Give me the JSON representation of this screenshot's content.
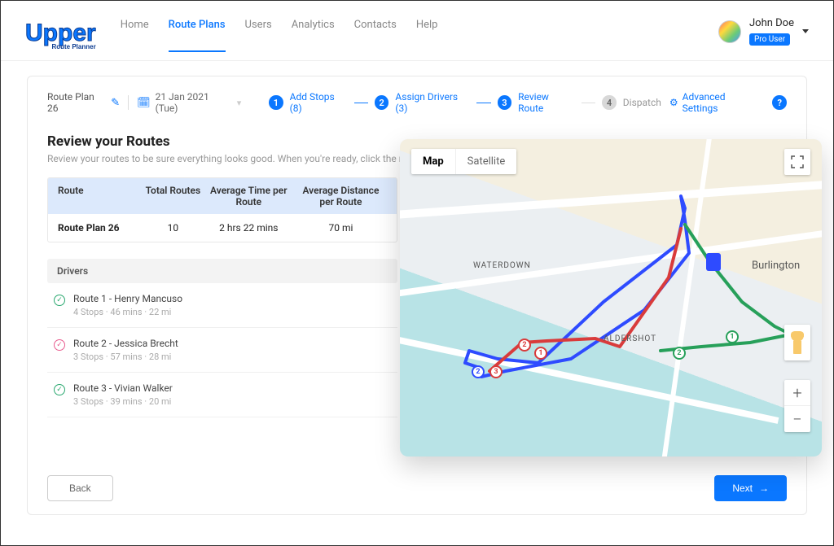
{
  "brand": {
    "name": "Upper",
    "tagline": "Route Planner"
  },
  "nav": {
    "items": [
      {
        "label": "Home"
      },
      {
        "label": "Route Plans",
        "active": true
      },
      {
        "label": "Users"
      },
      {
        "label": "Analytics"
      },
      {
        "label": "Contacts"
      },
      {
        "label": "Help"
      }
    ]
  },
  "user": {
    "name": "John Doe",
    "badge": "Pro User"
  },
  "plan": {
    "name": "Route Plan 26",
    "date": "21 Jan 2021 (Tue)"
  },
  "steps": [
    {
      "num": "1",
      "label": "Add Stops (8)",
      "active": true
    },
    {
      "num": "2",
      "label": "Assign Drivers (3)",
      "active": true
    },
    {
      "num": "3",
      "label": "Review Route",
      "active": true
    },
    {
      "num": "4",
      "label": "Dispatch",
      "active": false
    }
  ],
  "advanced_label": "Advanced Settings",
  "section": {
    "title": "Review your Routes",
    "subtitle": "Review your routes to be sure everything looks good. When you're ready, click the next button to dispatch."
  },
  "summary": {
    "headers": [
      "Route",
      "Total Routes",
      "Average Time per Route",
      "Average Distance per Route"
    ],
    "row": {
      "route": "Route Plan 26",
      "total": "10",
      "avg_time": "2 hrs 22 mins",
      "avg_dist": "70 mi"
    }
  },
  "drivers": {
    "header": "Drivers",
    "rows": [
      {
        "title": "Route 1 - Henry Mancuso",
        "meta": "4 Stops   ·   46 mins   ·   22 mi",
        "style": "green"
      },
      {
        "title": "Route 2 - Jessica Brecht",
        "meta": "3 Stops   ·   57 mins   ·   28 mi",
        "style": "pink"
      },
      {
        "title": "Route 3 - Vivian Walker",
        "meta": "3 Stops   ·   39 mins   ·   20 mi",
        "style": "green"
      }
    ]
  },
  "footer": {
    "back": "Back",
    "next": "Next"
  },
  "map": {
    "type_map": "Map",
    "type_sat": "Satellite",
    "cities": {
      "waterdown": "WATERDOWN",
      "aldershot": "ALDERSHOT",
      "burlington": "Burlington"
    },
    "pins": {
      "p1": "1",
      "p2": "2",
      "p3": "3",
      "g1": "1",
      "g2": "2"
    },
    "zoom": {
      "in": "+",
      "out": "−"
    }
  }
}
